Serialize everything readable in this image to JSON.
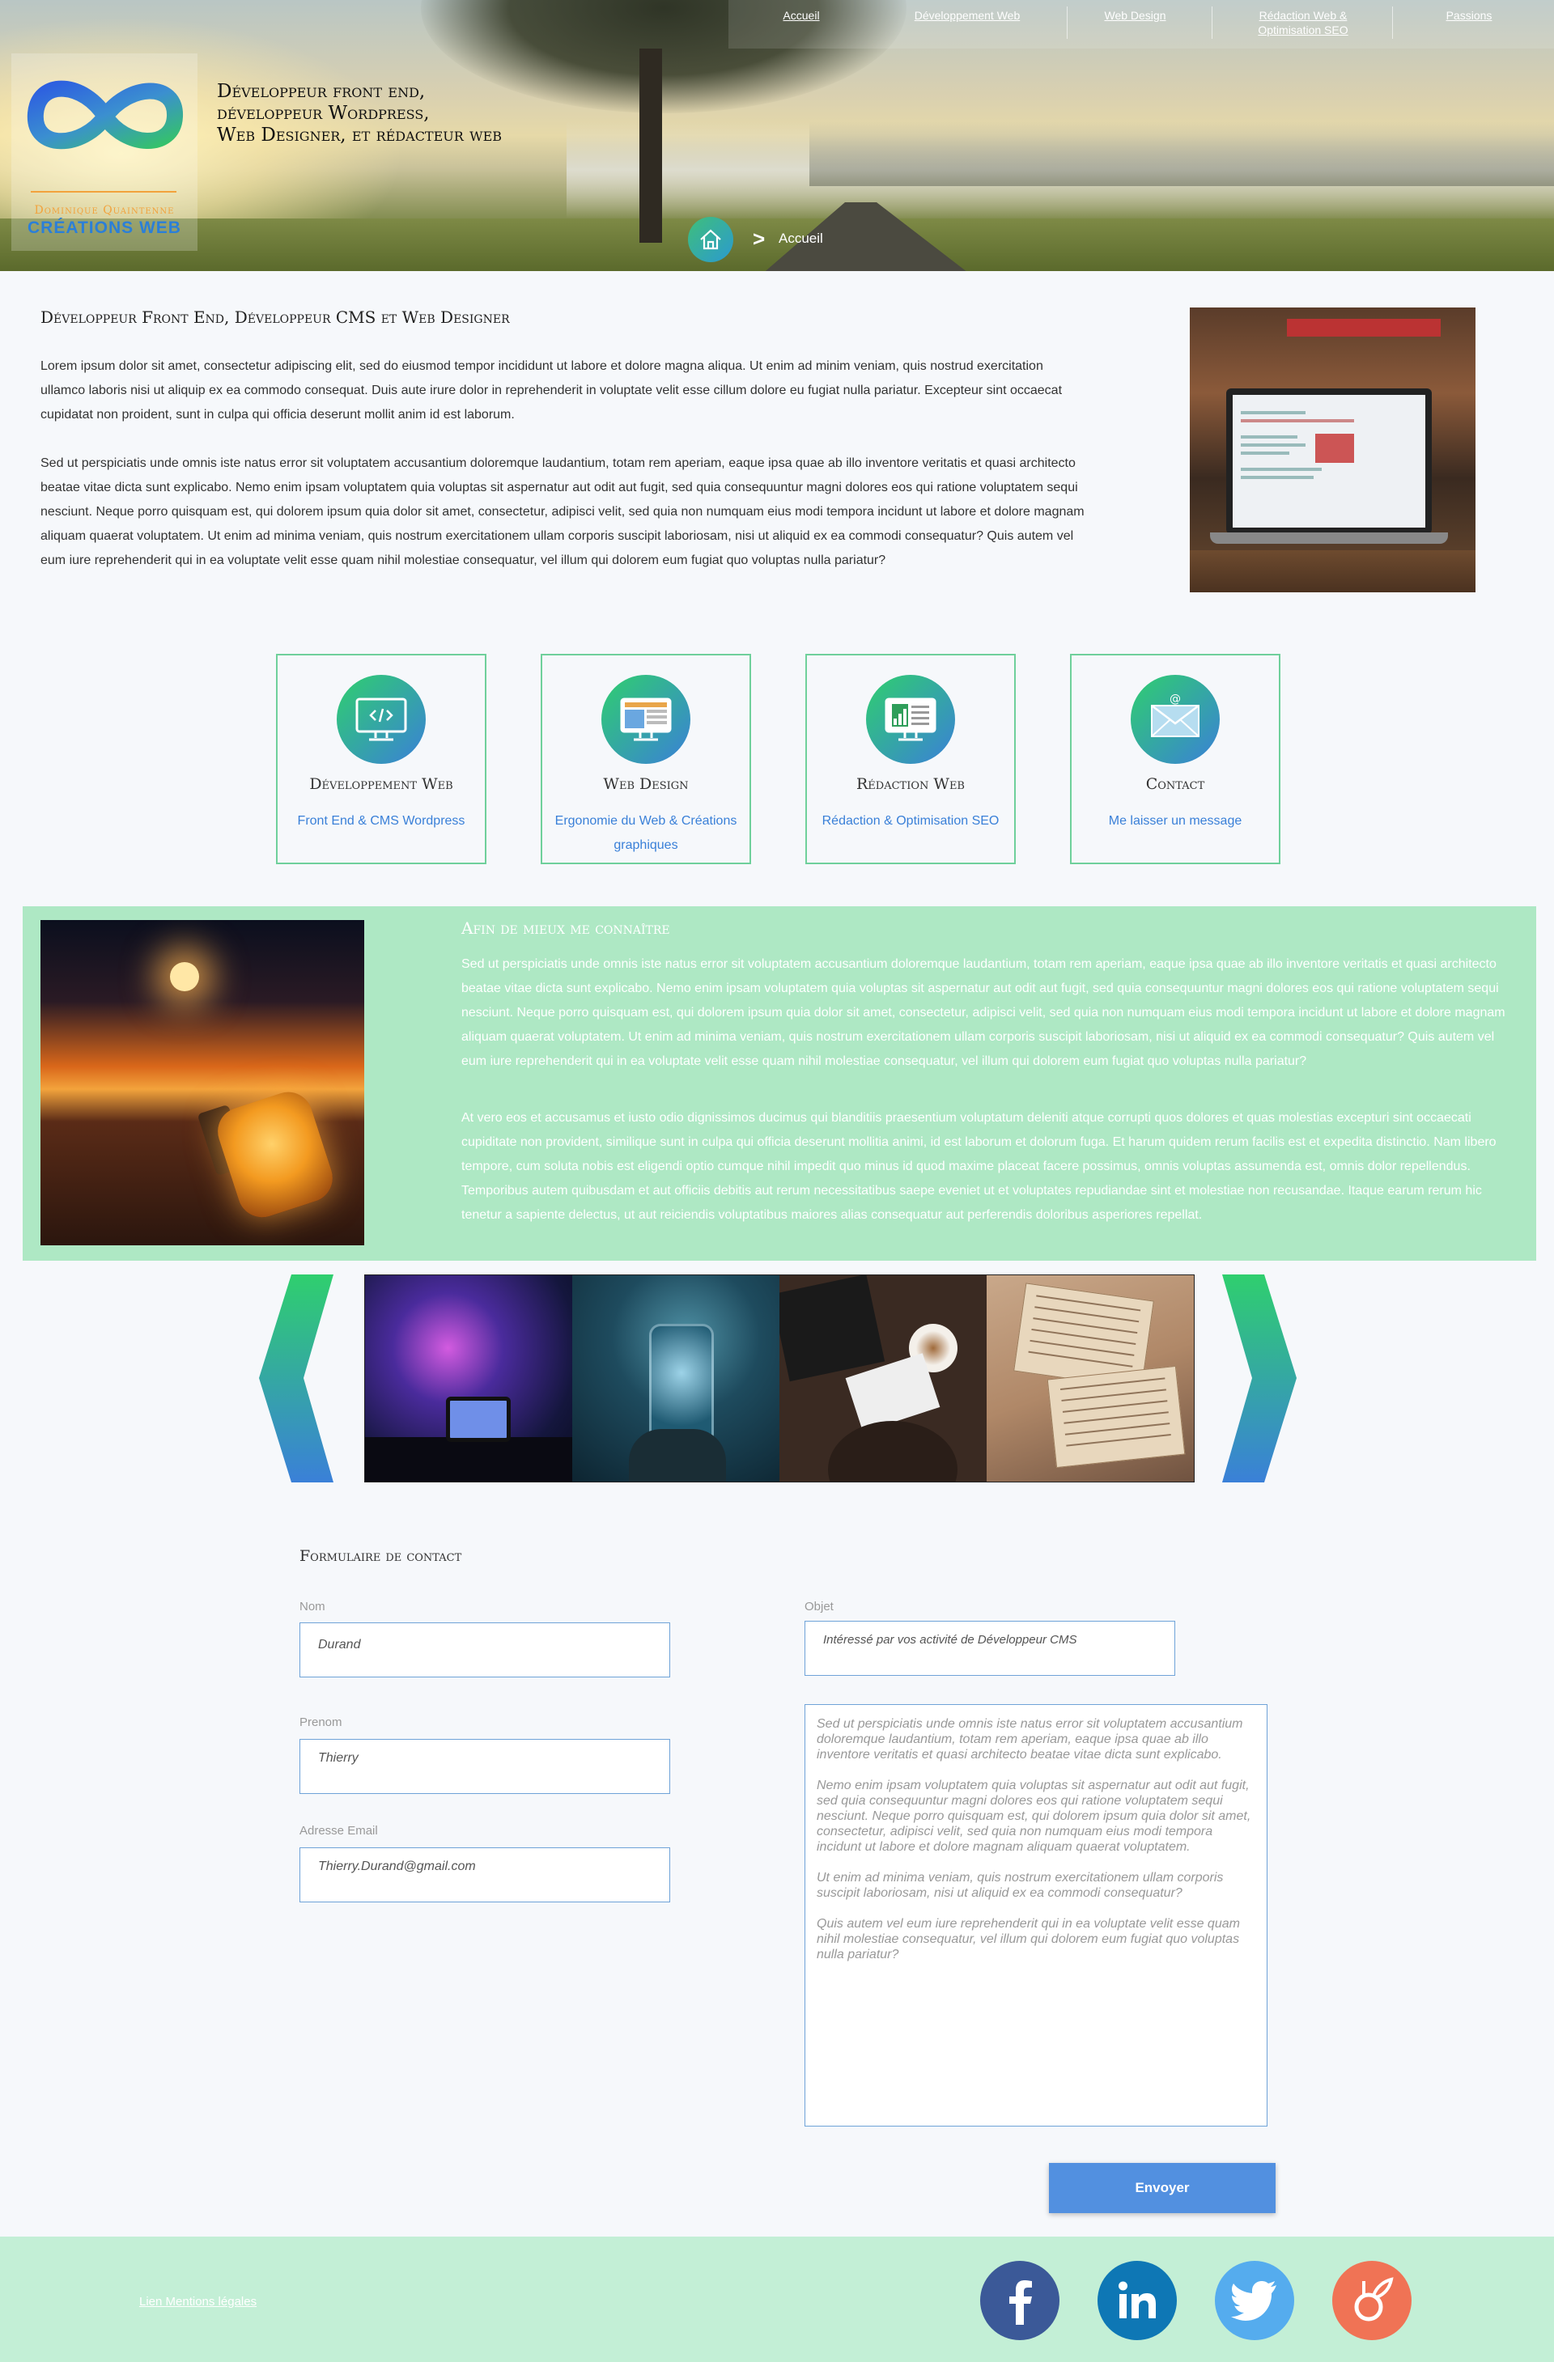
{
  "nav": {
    "items": [
      {
        "label": "Accueil"
      },
      {
        "label": "Développement Web"
      },
      {
        "label": "Web Design"
      },
      {
        "label": "Rédaction Web  &\nOptimisation SEO"
      },
      {
        "label": "Passions"
      }
    ]
  },
  "logo": {
    "name": "Dominique Quaintenne",
    "brand": "CRÉATIONS WEB"
  },
  "hero": {
    "tagline_1": "Développeur front end,",
    "tagline_2": "développeur Wordpress,",
    "tagline_3": "Web Designer, et rédacteur web",
    "breadcrumb_sep": ">",
    "breadcrumb": "Accueil"
  },
  "intro": {
    "title": "Développeur Front End, Développeur CMS et Web Designer",
    "p1": "Lorem ipsum dolor sit amet, consectetur adipiscing elit, sed do eiusmod tempor incididunt ut labore et dolore magna aliqua. Ut enim ad minim veniam, quis nostrud exercitation ullamco laboris nisi ut aliquip ex ea commodo consequat. Duis aute irure dolor in reprehenderit in voluptate velit esse cillum dolore eu fugiat nulla pariatur. Excepteur sint occaecat cupidatat non proident, sunt in culpa qui officia deserunt mollit anim id est laborum.",
    "p2": "Sed ut perspiciatis unde omnis iste natus error sit voluptatem accusantium doloremque laudantium, totam rem aperiam, eaque ipsa quae ab illo inventore veritatis et quasi architecto beatae vitae dicta sunt explicabo. Nemo enim ipsam voluptatem quia voluptas sit aspernatur aut odit aut fugit, sed quia consequuntur magni dolores eos qui ratione voluptatem sequi nesciunt. Neque porro quisquam est, qui dolorem ipsum quia dolor sit amet, consectetur, adipisci velit, sed quia non numquam eius modi tempora incidunt ut labore et dolore magnam aliquam quaerat voluptatem. Ut enim ad minima veniam, quis nostrum exercitationem ullam corporis suscipit laboriosam, nisi ut aliquid ex ea commodi consequatur? Quis autem vel eum iure reprehenderit qui in ea voluptate velit esse quam nihil molestiae consequatur, vel illum qui dolorem eum fugiat quo voluptas nulla pariatur?"
  },
  "services": [
    {
      "title": "Développement Web",
      "sub": "Front End & CMS Wordpress",
      "icon": "code-monitor-icon"
    },
    {
      "title": "Web Design",
      "sub": "Ergonomie du Web & Créations graphiques",
      "icon": "layout-monitor-icon"
    },
    {
      "title": "Rédaction Web",
      "sub": "Rédaction & Optimisation SEO",
      "icon": "document-monitor-icon"
    },
    {
      "title": "Contact",
      "sub": "Me laisser un message",
      "icon": "envelope-icon"
    }
  ],
  "about": {
    "title": "Afin de mieux me connaître",
    "p1": "Sed ut perspiciatis unde omnis iste natus error sit voluptatem accusantium doloremque laudantium, totam rem aperiam, eaque ipsa quae ab illo inventore veritatis et quasi architecto beatae vitae dicta sunt explicabo. Nemo enim ipsam voluptatem quia voluptas sit aspernatur aut odit aut fugit, sed quia consequuntur magni dolores eos qui ratione voluptatem sequi nesciunt. Neque porro quisquam est, qui dolorem ipsum quia dolor sit amet, consectetur, adipisci velit, sed quia non numquam eius modi tempora incidunt ut labore et dolore magnam aliquam quaerat voluptatem. Ut enim ad minima veniam, quis nostrum exercitationem ullam corporis suscipit laboriosam, nisi ut aliquid ex ea commodi consequatur? Quis autem vel eum iure reprehenderit qui in ea voluptate velit esse quam nihil molestiae consequatur, vel illum qui dolorem eum fugiat quo voluptas nulla pariatur?",
    "p2": "At vero eos et accusamus et iusto odio dignissimos ducimus qui blanditiis praesentium voluptatum deleniti atque corrupti quos dolores et quas molestias excepturi sint occaecati cupiditate non provident, similique sunt in culpa qui officia deserunt mollitia animi, id est laborum et dolorum fuga. Et harum quidem rerum facilis est et expedita distinctio. Nam libero tempore, cum soluta nobis est eligendi optio cumque nihil impedit quo minus id quod maxime placeat facere possimus, omnis voluptas assumenda est, omnis dolor repellendus. Temporibus autem quibusdam et aut officiis debitis aut rerum necessitatibus saepe eveniet ut et voluptates repudiandae sint et molestiae non recusandae. Itaque earum rerum hic tenetur a sapiente delectus, ut aut reiciendis voluptatibus maiores alias consequatur aut perferendis doloribus asperiores repellat."
  },
  "form": {
    "title": "Formulaire de contact",
    "nom_label": "Nom",
    "nom_value": "Durand",
    "prenom_label": "Prenom",
    "prenom_value": "Thierry",
    "email_label": "Adresse Email",
    "email_value": "Thierry.Durand@gmail.com",
    "objet_label": "Objet",
    "objet_value": "Intéressé par vos activité de Développeur CMS",
    "message_value": "Sed ut perspiciatis unde omnis iste natus error sit voluptatem accusantium doloremque laudantium, totam rem aperiam, eaque ipsa quae ab illo inventore veritatis et quasi architecto beatae vitae dicta sunt explicabo.\n\nNemo enim ipsam voluptatem quia voluptas sit aspernatur aut odit aut fugit, sed quia consequuntur magni dolores eos qui ratione voluptatem sequi nesciunt. Neque porro quisquam est, qui dolorem ipsum quia dolor sit amet, consectetur, adipisci velit, sed quia non numquam eius modi tempora incidunt ut labore et dolore magnam aliquam quaerat voluptatem.\n\nUt enim ad minima veniam, quis nostrum exercitationem ullam corporis suscipit laboriosam, nisi ut aliquid ex ea commodi consequatur?\n\nQuis autem vel eum iure reprehenderit qui in ea voluptate velit esse quam nihil molestiae consequatur, vel illum qui dolorem eum fugiat quo voluptas nulla pariatur?",
    "submit": "Envoyer"
  },
  "footer": {
    "legal": "Lien Mentions légales",
    "social": [
      "facebook-icon",
      "linkedin-icon",
      "twitter-icon",
      "viadeo-icon"
    ]
  },
  "colors": {
    "accent_green": "#6fd09b",
    "accent_blue": "#3a80d8",
    "about_bg": "#aee8c4",
    "footer_bg": "#c3efd6",
    "button": "#5290e0"
  }
}
